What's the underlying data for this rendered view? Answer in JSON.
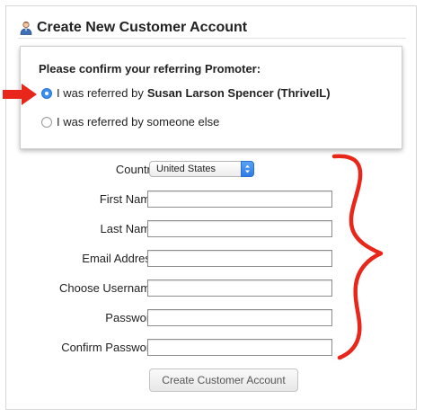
{
  "header": {
    "title": "Create New Customer Account",
    "icon": "user-icon"
  },
  "referral": {
    "prompt": "Please confirm your referring Promoter:",
    "option_promoter_prefix": "I was referred by",
    "option_promoter_name": "Susan Larson Spencer (ThriveIL)",
    "option_promoter_selected": true,
    "option_other_label": "I was referred by someone else",
    "option_other_selected": false
  },
  "form": {
    "country_label": "Country:",
    "country_value": "United States",
    "first_name_label": "First Name:",
    "first_name_value": "",
    "last_name_label": "Last Name:",
    "last_name_value": "",
    "email_label": "Email Address:",
    "email_value": "",
    "username_label": "Choose Username:",
    "username_value": "",
    "password_label": "Password:",
    "password_value": "",
    "confirm_password_label": "Confirm Password:",
    "confirm_password_value": "",
    "submit_label": "Create Customer Account"
  },
  "annotations": {
    "arrow_color": "#e8261a",
    "brace_color": "#e8261a"
  },
  "colors": {
    "radio_selected": "#3a8ff0",
    "select_stepper": "#2d7be6"
  }
}
